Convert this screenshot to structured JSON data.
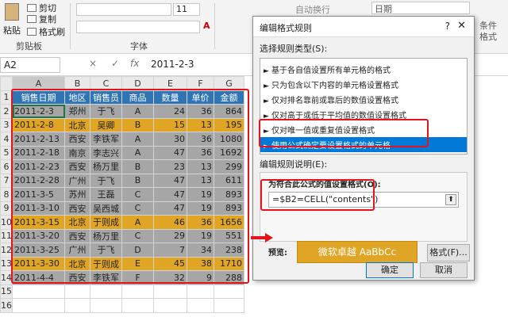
{
  "ribbon": {
    "paste_label": "粘贴",
    "cut_label": "剪切",
    "copy_label": "复制",
    "format_painter_label": "格式刷",
    "clipboard_group": "剪贴板",
    "font_group": "字体",
    "font_size": "11",
    "wrap_text_label": "自动换行",
    "number_format": "日期",
    "font_color_sample": "A",
    "right_edge_label": "条件",
    "right_edge_label2": "格式"
  },
  "formula_bar": {
    "name_box": "A2",
    "cancel_icon": "×",
    "enter_icon": "✓",
    "fx_icon": "fx",
    "formula_value": "2011-2-3"
  },
  "sheet": {
    "columns": [
      "A",
      "B",
      "C",
      "D",
      "E",
      "F",
      "G"
    ],
    "row_numbers": [
      "1",
      "2",
      "3",
      "4",
      "5",
      "6",
      "7",
      "8",
      "9",
      "10",
      "11",
      "12",
      "13",
      "14",
      "15",
      "16"
    ],
    "headers": [
      "销售日期",
      "地区",
      "销售员",
      "商品",
      "数量",
      "单价",
      "金额"
    ],
    "rows": [
      {
        "date": "2011-2-3",
        "region": "郑州",
        "rep": "于飞",
        "product": "A",
        "qty": "24",
        "price": "36",
        "amount": "864",
        "style": "gray"
      },
      {
        "date": "2011-2-8",
        "region": "北京",
        "rep": "吴卿",
        "product": "B",
        "qty": "15",
        "price": "13",
        "amount": "195",
        "style": "gold"
      },
      {
        "date": "2011-2-13",
        "region": "西安",
        "rep": "李铁军",
        "product": "A",
        "qty": "30",
        "price": "36",
        "amount": "1080",
        "style": "gray"
      },
      {
        "date": "2011-2-18",
        "region": "南京",
        "rep": "李志兴",
        "product": "A",
        "qty": "47",
        "price": "36",
        "amount": "1692",
        "style": "gray"
      },
      {
        "date": "2011-2-23",
        "region": "西安",
        "rep": "杨万里",
        "product": "B",
        "qty": "23",
        "price": "13",
        "amount": "299",
        "style": "gray"
      },
      {
        "date": "2011-2-28",
        "region": "广州",
        "rep": "于飞",
        "product": "B",
        "qty": "47",
        "price": "13",
        "amount": "611",
        "style": "gray"
      },
      {
        "date": "2011-3-5",
        "region": "苏州",
        "rep": "王磊",
        "product": "C",
        "qty": "47",
        "price": "19",
        "amount": "893",
        "style": "gray"
      },
      {
        "date": "2011-3-10",
        "region": "西安",
        "rep": "吴西城",
        "product": "C",
        "qty": "47",
        "price": "19",
        "amount": "893",
        "style": "gray"
      },
      {
        "date": "2011-3-15",
        "region": "北京",
        "rep": "于则成",
        "product": "A",
        "qty": "46",
        "price": "36",
        "amount": "1656",
        "style": "gold"
      },
      {
        "date": "2011-3-20",
        "region": "西安",
        "rep": "杨万里",
        "product": "C",
        "qty": "29",
        "price": "19",
        "amount": "551",
        "style": "gray"
      },
      {
        "date": "2011-3-25",
        "region": "广州",
        "rep": "于飞",
        "product": "D",
        "qty": "7",
        "price": "34",
        "amount": "238",
        "style": "gray"
      },
      {
        "date": "2011-3-30",
        "region": "北京",
        "rep": "于则成",
        "product": "E",
        "qty": "45",
        "price": "38",
        "amount": "1710",
        "style": "gold"
      },
      {
        "date": "2011-4-4",
        "region": "西安",
        "rep": "李铁军",
        "product": "F",
        "qty": "32",
        "price": "9",
        "amount": "288",
        "style": "gray"
      }
    ]
  },
  "dialog": {
    "title": "编辑格式规则",
    "help": "?",
    "close": "✕",
    "rule_type_label": "选择规则类型(S):",
    "rules": [
      "基于各自值设置所有单元格的格式",
      "只为包含以下内容的单元格设置格式",
      "仅对排名靠前或靠后的数值设置格式",
      "仅对高于或低于平均值的数值设置格式",
      "仅对唯一值或重复值设置格式",
      "使用公式确定要设置格式的单元格"
    ],
    "rule_arrow": "►",
    "edit_desc_label": "编辑规则说明(E):",
    "formula_label": "为符合此公式的值设置格式(O):",
    "formula": "=$B2=CELL(\"contents\")",
    "collapse_icon": "⬆",
    "preview_label": "预览:",
    "preview_text": "微软卓越  AaBbCc",
    "format_button": "格式(F)...",
    "ok_button": "确定",
    "cancel_button": "取消"
  },
  "colors": {
    "header_blue": "#2f74b5",
    "highlight_gold": "#e0a524",
    "row_gray": "#a6a6a6",
    "annotation_red": "#e3141c",
    "selected_rule": "#0078d7"
  }
}
